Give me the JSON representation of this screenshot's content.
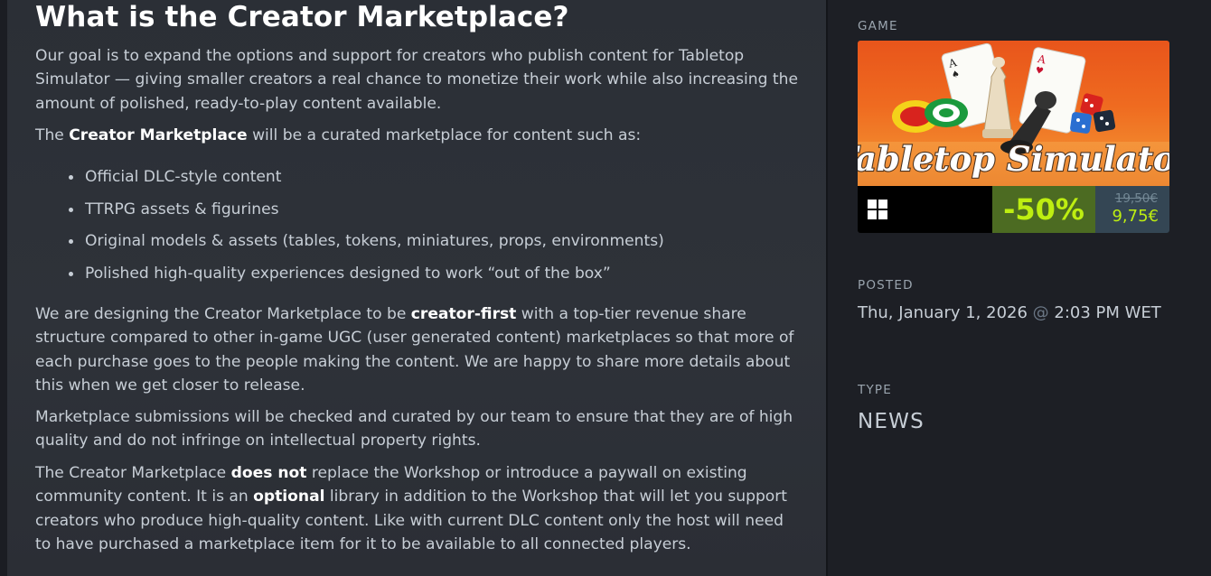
{
  "article": {
    "heading": "What is the Creator Marketplace?",
    "p1": "Our goal is to expand the options and support for creators who publish content for Tabletop Simulator — giving smaller creators a real chance to monetize their work while also increasing the amount of polished, ready-to-play content available.",
    "p2_pre": "The ",
    "p2_bold": "Creator Marketplace",
    "p2_post": " will be a curated marketplace for content such as:",
    "bullets": [
      "Official DLC-style content",
      "TTRPG assets & figurines",
      "Original models & assets (tables, tokens, miniatures, props, environments)",
      "Polished high-quality experiences designed to work “out of the box”"
    ],
    "p3_pre": "We are designing the Creator Marketplace to be ",
    "p3_bold": "creator-first",
    "p3_post": " with a top-tier revenue share structure compared to other in-game UGC (user generated content) marketplaces so that more of each purchase goes to the people making the content. We are happy to share more details about this when we get closer to release.",
    "p4": "Marketplace submissions will be checked and curated by our team to ensure that they are of high quality and do not infringe on intellectual property rights.",
    "p5_a": "The Creator Marketplace ",
    "p5_b": "does not",
    "p5_c": " replace the Workshop or introduce a paywall on existing community content. It is an ",
    "p5_d": "optional",
    "p5_e": " library in addition to the Workshop that will let you support creators who produce high-quality content. Like with current DLC content only the host will need to have purchased a marketplace item for it to be available to all connected players."
  },
  "sidebar": {
    "game_label": "GAME",
    "game": {
      "title": "Tabletop Simulator",
      "platform_icon": "windows-icon",
      "discount": "-50%",
      "original_price": "19,50€",
      "final_price": "9,75€"
    },
    "posted_label": "POSTED",
    "posted_date": "Thu, January 1, 2026",
    "posted_at": "@",
    "posted_time": "2:03 PM WET",
    "type_label": "TYPE",
    "type_value": "NEWS"
  },
  "colors": {
    "background": "#1b1d23",
    "panel": "#2e3239",
    "discount_bg": "#4c6b22",
    "discount_text": "#beee11",
    "price_bg": "#344654"
  }
}
